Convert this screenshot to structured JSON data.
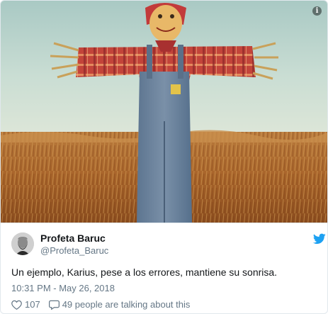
{
  "tweet": {
    "author_name": "Profeta Baruc",
    "author_handle": "@Profeta_Baruc",
    "text": "Un ejemplo, Karius, pese a los errores, mantiene su sonrisa.",
    "timestamp": "10:31 PM - May 26, 2018",
    "likes": "107",
    "talking": "49 people are talking about this"
  },
  "icons": {
    "info": "info-icon",
    "brand": "twitter-bird-icon",
    "like": "heart-icon",
    "reply": "speech-bubble-icon"
  },
  "colors": {
    "brand": "#1da1f2",
    "secondary_text": "#657786",
    "primary_text": "#14171a",
    "border": "#e1e8ed"
  }
}
